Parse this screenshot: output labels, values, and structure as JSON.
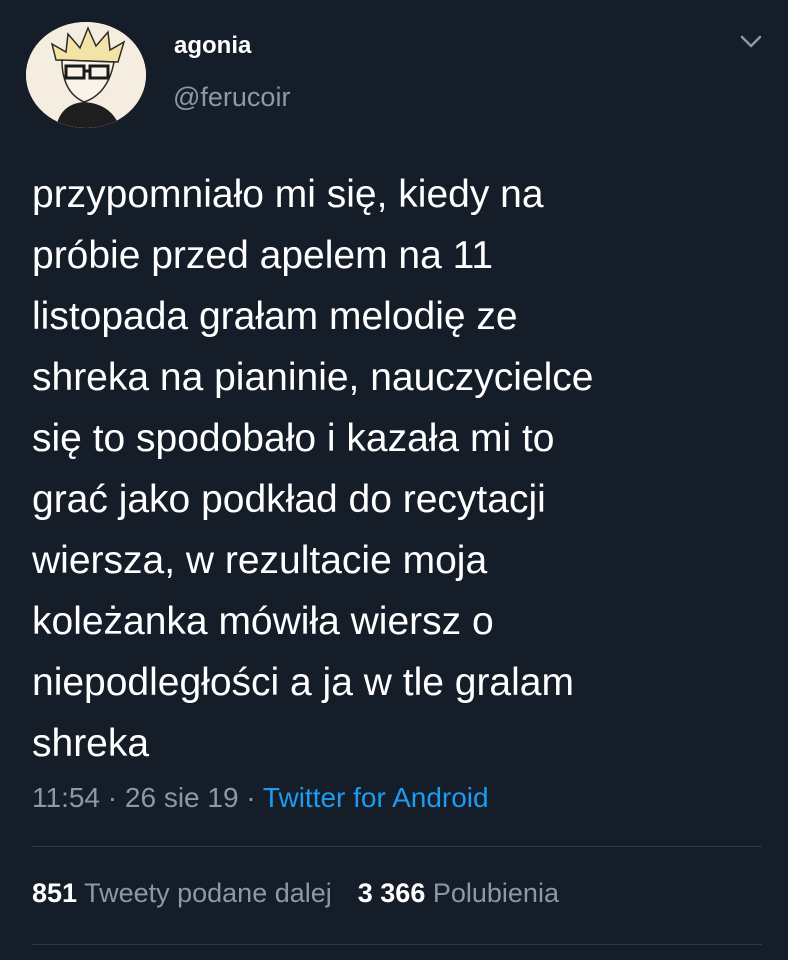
{
  "user": {
    "display_name": "agonia",
    "handle": "@ferucoir",
    "avatar": "anime-character-avatar"
  },
  "menu_icon": "chevron-down-icon",
  "tweet": {
    "text": "przypomniało mi się, kiedy na\npróbie przed apelem na 11\nlistopada grałam melodię ze\nshreka na pianinie, nauczycielce\nsię to spodobało i kazała mi to\ngrać jako podkład do recytacji\nwiersza, w rezultacie moja\nkoleżanka mówiła wiersz o\nniepodległości a ja w tle gralam\nshreka",
    "time": "11:54",
    "date": "26 sie 19",
    "separator": " · ",
    "source": "Twitter for Android"
  },
  "stats": {
    "retweets_count": "851",
    "retweets_label": "Tweety podane dalej",
    "likes_count": "3 366",
    "likes_label": "Polubienia"
  },
  "colors": {
    "background": "#151d29",
    "text": "#ffffff",
    "secondary": "#8b98a5",
    "link": "#1d9bf0"
  }
}
